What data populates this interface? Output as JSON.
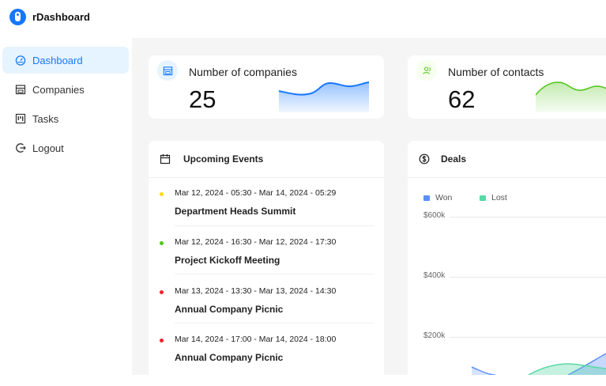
{
  "app": {
    "name": "rDashboard"
  },
  "sidebar": {
    "items": [
      {
        "label": "Dashboard",
        "icon": "dashboard-icon",
        "active": true
      },
      {
        "label": "Companies",
        "icon": "shop-icon"
      },
      {
        "label": "Tasks",
        "icon": "project-board-icon"
      },
      {
        "label": "Logout",
        "icon": "logout-icon"
      }
    ]
  },
  "stats": [
    {
      "title": "Number of companies",
      "value": "25",
      "icon": "shop-icon",
      "color": "#1677ff"
    },
    {
      "title": "Number of contacts",
      "value": "62",
      "icon": "team-icon",
      "color": "#52c41a"
    }
  ],
  "events": {
    "title": "Upcoming Events",
    "icon": "calendar-icon",
    "items": [
      {
        "time": "Mar 12, 2024 - 05:30 - Mar 14, 2024 - 05:29",
        "name": "Department Heads Summit",
        "color": "#fadb14"
      },
      {
        "time": "Mar 12, 2024 - 16:30 - Mar 12, 2024 - 17:30",
        "name": "Project Kickoff Meeting",
        "color": "#52c41a"
      },
      {
        "time": "Mar 13, 2024 - 13:30 - Mar 13, 2024 - 14:30",
        "name": "Annual Company Picnic",
        "color": "#f5222d"
      },
      {
        "time": "Mar 14, 2024 - 17:00 - Mar 14, 2024 - 18:00",
        "name": "Annual Company Picnic",
        "color": "#f5222d"
      }
    ]
  },
  "deals": {
    "title": "Deals",
    "icon": "dollar-icon",
    "legend": [
      {
        "label": "Won",
        "color": "#5b8ff9"
      },
      {
        "label": "Lost",
        "color": "#5ad8a6"
      }
    ],
    "yticks": [
      "$600k",
      "$400k",
      "$200k"
    ]
  }
}
